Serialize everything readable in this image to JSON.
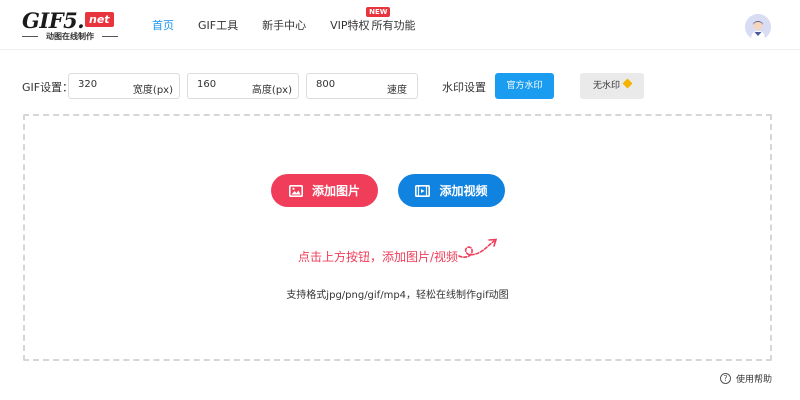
{
  "logo": {
    "main": "GIF5.",
    "badge": "net",
    "subtitle": "动图在线制作"
  },
  "nav": {
    "items": [
      {
        "label": "首页",
        "active": true
      },
      {
        "label": "GIF工具"
      },
      {
        "label": "新手中心"
      },
      {
        "label": "VIP特权",
        "badge": "NEW"
      },
      {
        "label": "所有功能"
      }
    ]
  },
  "settings": {
    "label": "GIF设置：",
    "width": {
      "value": "320",
      "unit": "宽度(px)"
    },
    "height": {
      "value": "160",
      "unit": "高度(px)"
    },
    "speed": {
      "value": "800",
      "unit": "速度"
    },
    "watermark_label": "水印设置",
    "official_watermark": "官方水印",
    "no_watermark": "无水印"
  },
  "upload": {
    "add_image": "添加图片",
    "add_video": "添加视频",
    "hint": "点击上方按钮，添加图片/视频",
    "formats": "支持格式jpg/png/gif/mp4，轻松在线制作gif动图"
  },
  "help": {
    "label": "使用帮助"
  },
  "colors": {
    "accent": "#1a9df0",
    "image_button": "#ef3d5a",
    "video_button": "#1082df",
    "badge": "#e8343c"
  }
}
